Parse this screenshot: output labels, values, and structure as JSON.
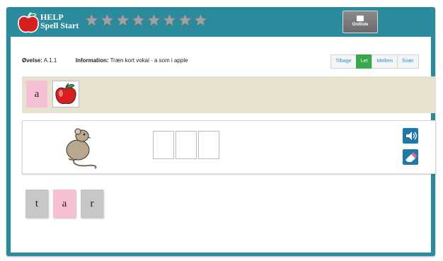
{
  "app": {
    "brand_line1": "HELP",
    "brand_line2": "Spell Start",
    "stars_count": 8,
    "logo_icon": "apple-icon",
    "accent": "#2b8a9b"
  },
  "header": {
    "dictionary_label": "Ordliste",
    "dictionary_icon": "book-icon"
  },
  "exercise": {
    "label": "Øvelse:",
    "value": "A.1.1",
    "info_label": "Information:",
    "info_text": "Træn kort vokal - a som i apple"
  },
  "levels": [
    {
      "label": "Tilbage",
      "active": false
    },
    {
      "label": "Let",
      "active": true
    },
    {
      "label": "Mellem",
      "active": false
    },
    {
      "label": "Svær",
      "active": false
    }
  ],
  "target": {
    "letter": "a",
    "picture": "apple-icon"
  },
  "workspace": {
    "picture": "rat-icon",
    "slots": 3,
    "tools": [
      "speaker-icon",
      "eraser-icon"
    ]
  },
  "tiles": [
    {
      "letter": "t",
      "color": "gray"
    },
    {
      "letter": "a",
      "color": "pink"
    },
    {
      "letter": "r",
      "color": "gray"
    }
  ],
  "colors": {
    "accent": "#2b8a9b",
    "active_level": "#39a84a",
    "vowel_tile": "#f6bfd3",
    "consonant_tile": "#c7c7c7",
    "target_bg": "#e7e2cf"
  }
}
